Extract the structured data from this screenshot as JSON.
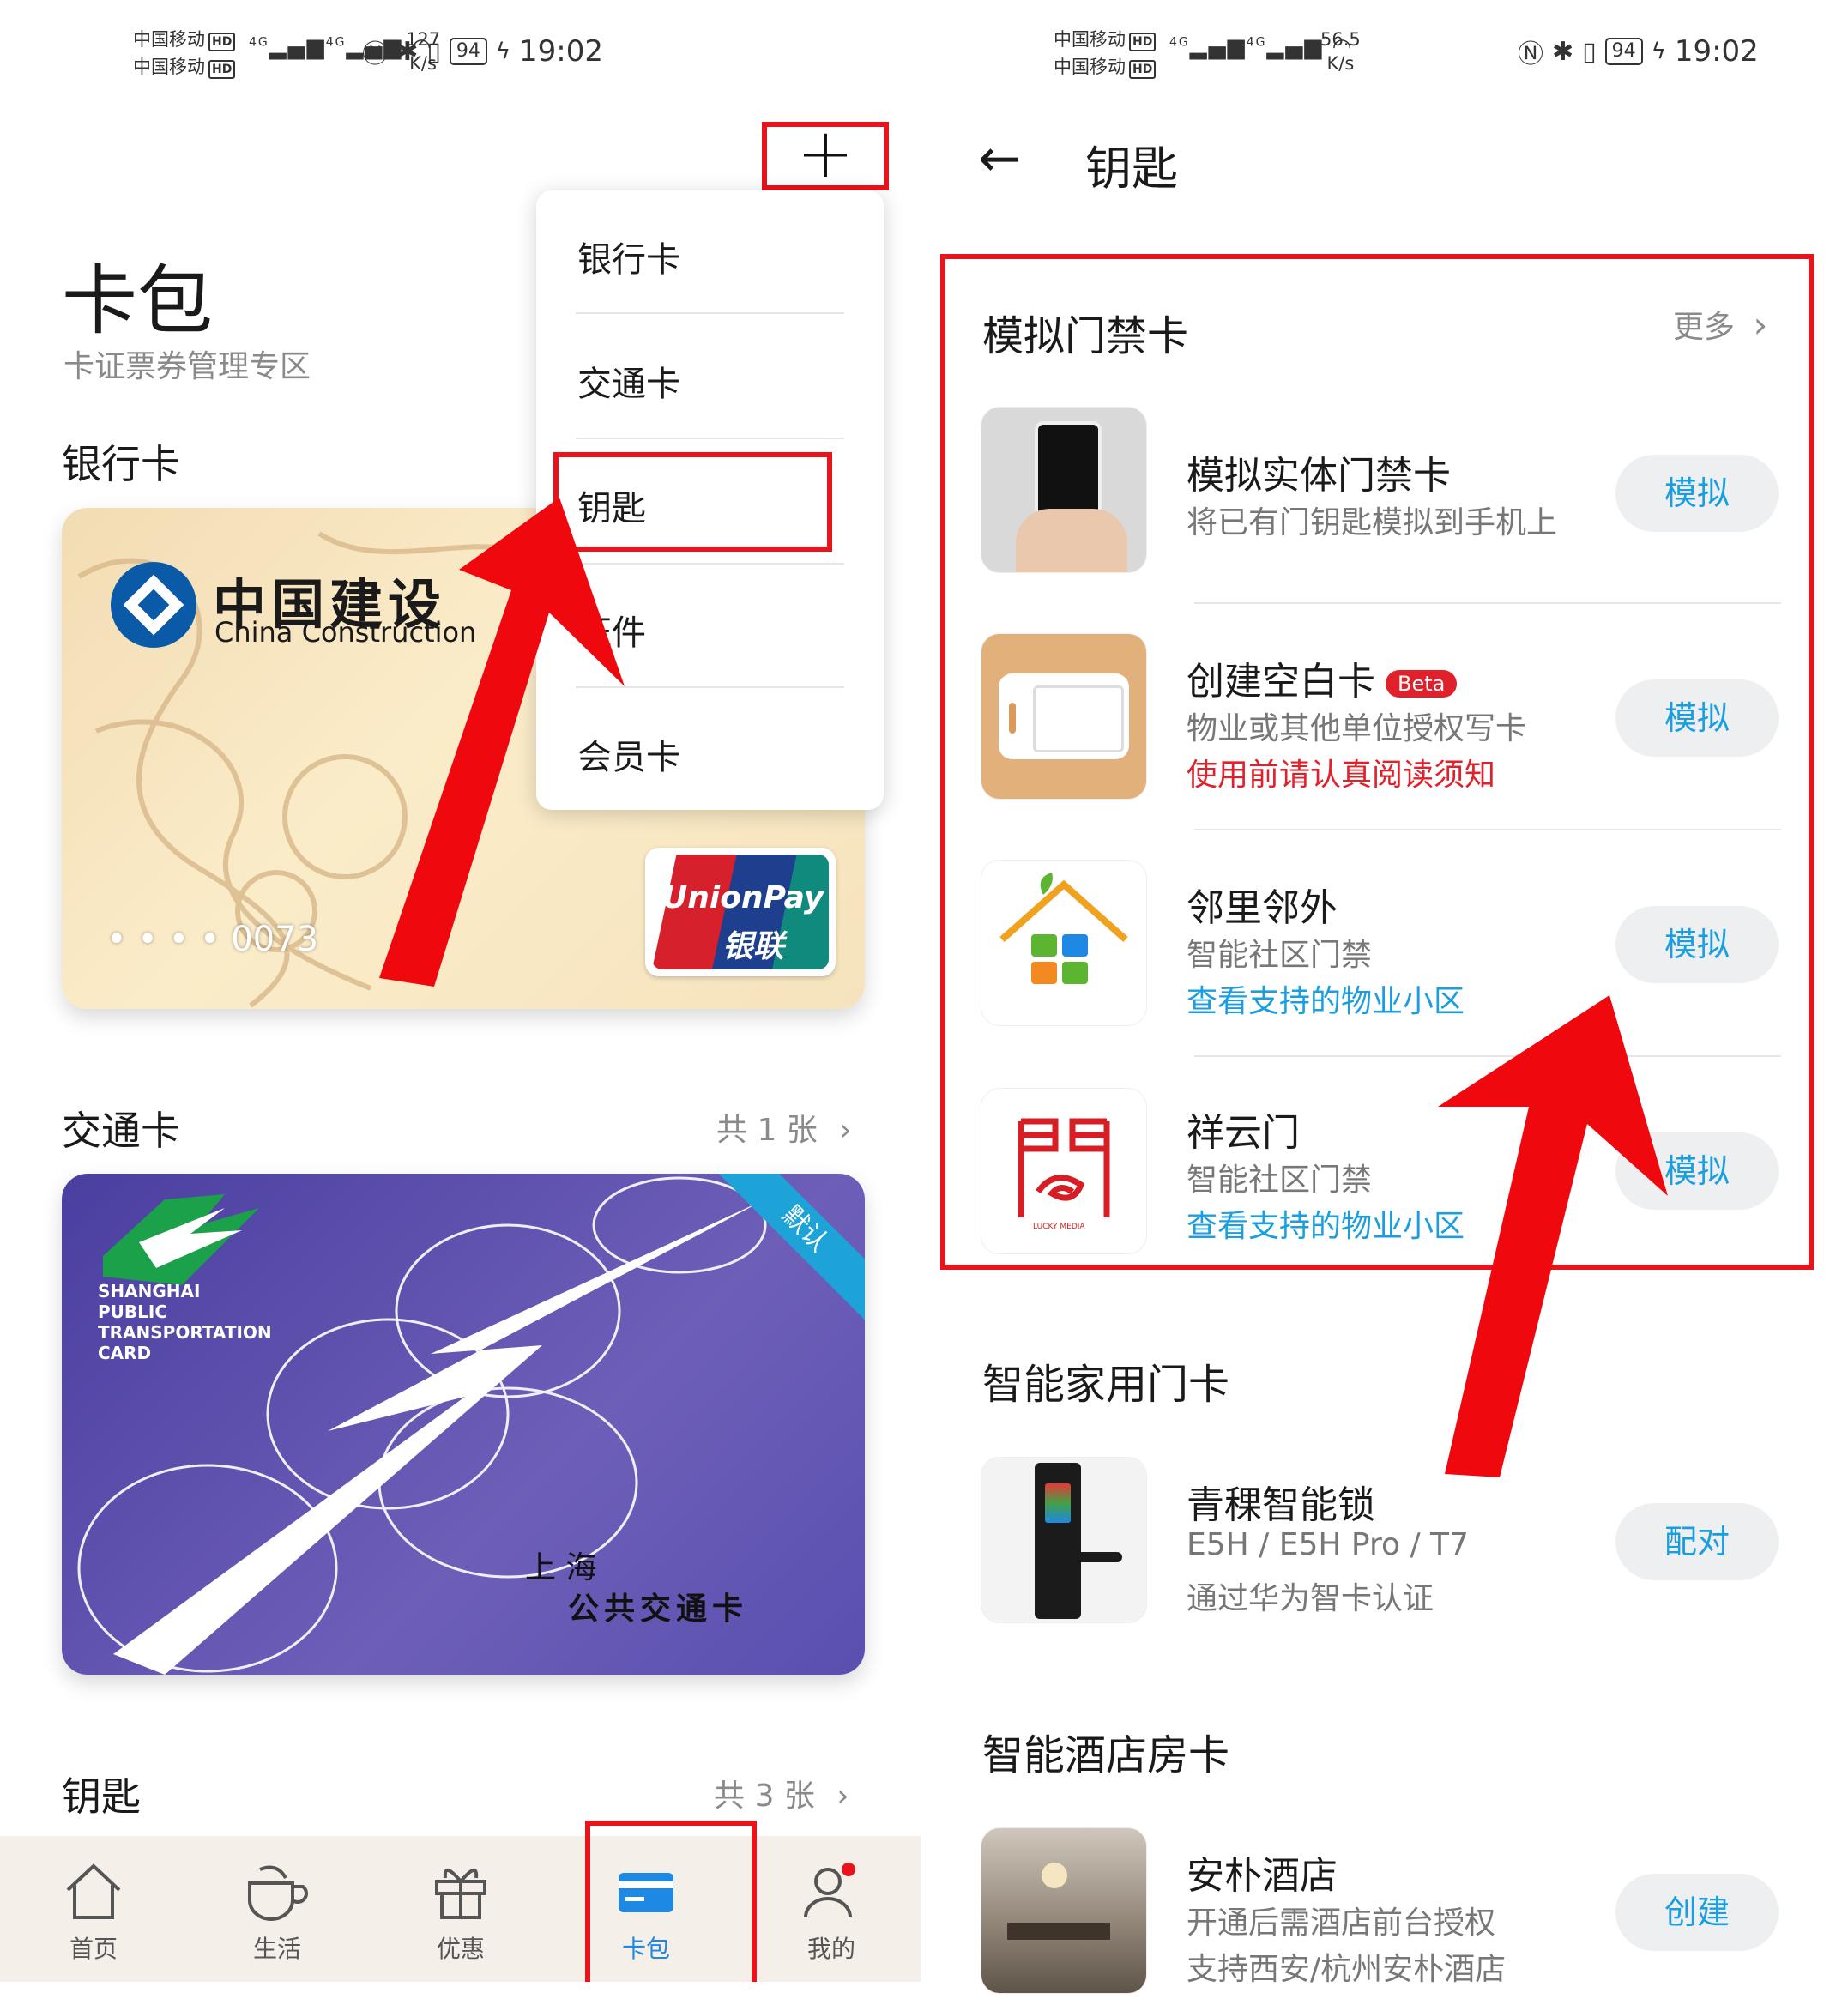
{
  "status_bar_left": {
    "carrier1": "中国移动",
    "carrier2": "中国移动",
    "hd": "HD",
    "net": "4G",
    "speed_value": "127",
    "speed_unit": "K/s",
    "battery": "94",
    "time": "19:02"
  },
  "status_bar_right": {
    "carrier1": "中国移动",
    "carrier2": "中国移动",
    "hd": "HD",
    "net": "4G",
    "speed_value": "56.5",
    "speed_unit": "K/s",
    "battery": "94",
    "time": "19:02"
  },
  "wallet": {
    "title": "卡包",
    "subtitle": "卡证票券管理专区",
    "bank_section": "银行卡",
    "bank_card": {
      "bank_name_cn": "中国建设",
      "bank_name_en": "China Construction",
      "number": "• • • • 0073",
      "unionpay_en": "UnionPay",
      "unionpay_cn": "银联"
    },
    "transit_section": "交通卡",
    "transit_count": "共 1 张",
    "transit_card": {
      "text_en_1": "SHANGHAI",
      "text_en_2": "PUBLIC",
      "text_en_3": "TRANSPORTATION",
      "text_en_4": "CARD",
      "text_cn_1": "上 海",
      "text_cn_2": "公共交通卡",
      "badge": "默认"
    },
    "key_section": "钥匙",
    "key_count": "共 3 张",
    "add_menu": [
      "银行卡",
      "交通卡",
      "钥匙",
      "证件",
      "会员卡"
    ]
  },
  "nav": [
    {
      "label": "首页"
    },
    {
      "label": "生活"
    },
    {
      "label": "优惠"
    },
    {
      "label": "卡包"
    },
    {
      "label": "我的"
    }
  ],
  "keys_page": {
    "title": "钥匙",
    "section1": "模拟门禁卡",
    "more": "更多",
    "items": [
      {
        "title": "模拟实体门禁卡",
        "desc": "将已有门钥匙模拟到手机上",
        "button": "模拟"
      },
      {
        "title": "创建空白卡",
        "badge": "Beta",
        "desc": "物业或其他单位授权写卡",
        "warn": "使用前请认真阅读须知",
        "button": "模拟"
      },
      {
        "title": "邻里邻外",
        "desc": "智能社区门禁",
        "link": "查看支持的物业小区",
        "button": "模拟"
      },
      {
        "title": "祥云门",
        "desc": "智能社区门禁",
        "link": "查看支持的物业小区",
        "button": "模拟",
        "logo_text": "LUCKY MEDIA"
      }
    ],
    "section2": "智能家用门卡",
    "home_item": {
      "title": "青稞智能锁",
      "desc": "E5H / E5H Pro / T7",
      "desc2": "通过华为智卡认证",
      "button": "配对"
    },
    "section3": "智能酒店房卡",
    "hotel_item": {
      "title": "安朴酒店",
      "desc": "开通后需酒店前台授权",
      "desc2": "支持西安/杭州安朴酒店",
      "button": "创建"
    }
  },
  "colors": {
    "highlight": "#e8141b",
    "link": "#1a9ee0",
    "accent_blue": "#1e88e5"
  }
}
